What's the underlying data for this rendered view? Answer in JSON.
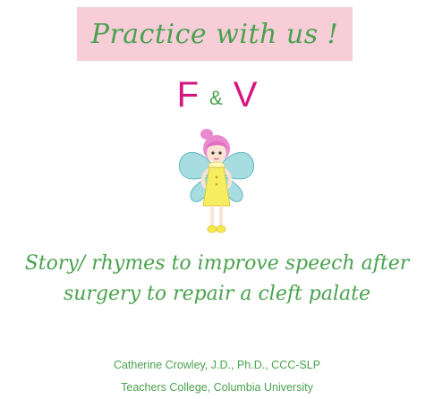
{
  "banner": {
    "title": "Practice with us !",
    "background": "#f7cdd8",
    "text_color": "#4aa24e"
  },
  "letters": {
    "first": "F",
    "connector": "&",
    "second": "V",
    "letter_color": "#d6157f",
    "connector_color": "#4aa24e"
  },
  "illustration": {
    "icon": "fairy-icon"
  },
  "story": {
    "line1": "Story/ rhymes to improve speech after",
    "line2": "surgery to repair a cleft palate"
  },
  "credits": {
    "author": "Catherine Crowley, J.D., Ph.D., CCC-SLP",
    "affiliation": "Teachers College, Columbia University"
  }
}
